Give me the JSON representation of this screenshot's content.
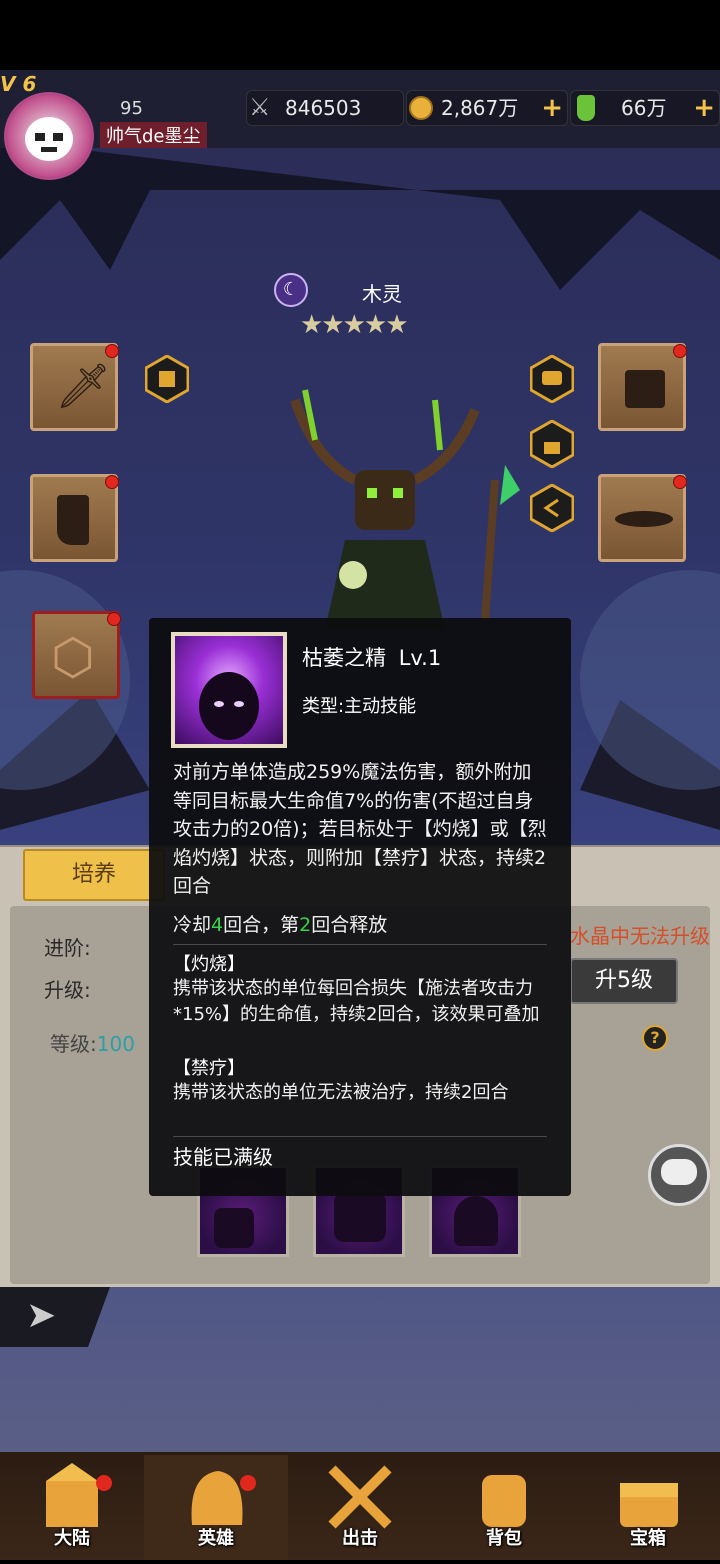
{
  "player": {
    "vip": "V 6",
    "level": "95",
    "name": "帅气de墨尘"
  },
  "resources": {
    "power": "846503",
    "gold": "2,867万",
    "potion": "66万"
  },
  "hero": {
    "name": "木灵",
    "stars": 5
  },
  "panel": {
    "tab_cultivate": "培养",
    "advance_label": "进阶:",
    "upgrade_label": "升级:",
    "upgrade_button": "升5级",
    "level_label": "等级:",
    "level_value": "100",
    "warning_text": "水晶中无法升级"
  },
  "popup": {
    "skill_name": "枯萎之精",
    "skill_level": "Lv.1",
    "skill_type": "类型:主动技能",
    "description": "对前方单体造成259%魔法伤害，额外附加等同目标最大生命值7%的伤害(不超过自身攻击力的20倍)；若目标处于【灼烧】或【烈焰灼烧】状态，则附加【禁疗】状态，持续2回合",
    "cooldown_prefix": "冷却",
    "cooldown_value": "4",
    "cooldown_mid": "回合，第",
    "release_value": "2",
    "cooldown_suffix": "回合释放",
    "burn_title": "【灼烧】",
    "burn_desc": "携带该状态的单位每回合损失【施法者攻击力*15%】的生命值，持续2回合，该效果可叠加",
    "heal_ban_title": "【禁疗】",
    "heal_ban_desc": "携带该状态的单位无法被治疗，持续2回合",
    "maxed": "技能已满级"
  },
  "nav": [
    {
      "label": "大陆"
    },
    {
      "label": "英雄"
    },
    {
      "label": "出击"
    },
    {
      "label": "背包"
    },
    {
      "label": "宝箱"
    }
  ],
  "colors": {
    "accent_green": "#39d24a",
    "gold": "#f3c24a",
    "badge_red": "#e2271e"
  }
}
